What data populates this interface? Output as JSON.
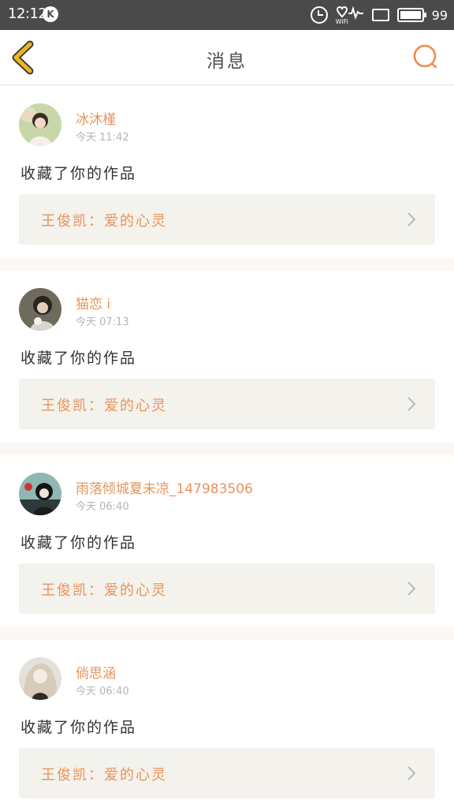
{
  "status_bar": {
    "time": "12:12",
    "k_badge": "K",
    "wifi_label": "WiFi",
    "battery_level": "99"
  },
  "nav": {
    "title": "消息"
  },
  "colors": {
    "accent": "#e8935c",
    "back_arrow": "#f1b51c",
    "search": "#f08a4b"
  },
  "messages": [
    {
      "username": "冰沐槿",
      "time": "今天 11:42",
      "action": "收藏了你的作品",
      "work_title": "王俊凯：爱的心灵"
    },
    {
      "username": "猫恋 i",
      "time": "今天 07:13",
      "action": "收藏了你的作品",
      "work_title": "王俊凯：爱的心灵"
    },
    {
      "username": "雨落倾城夏未凉_147983506",
      "time": "今天 06:40",
      "action": "收藏了你的作品",
      "work_title": "王俊凯：爱的心灵"
    },
    {
      "username": "倘思涵",
      "time": "今天 06:40",
      "action": "收藏了你的作品",
      "work_title": "王俊凯：爱的心灵"
    }
  ]
}
